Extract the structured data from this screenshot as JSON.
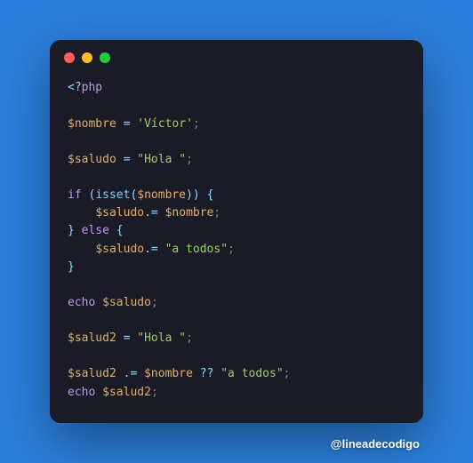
{
  "credits": "@lineadecodigo",
  "code": {
    "l1": {
      "open": "<?",
      "php": "php"
    },
    "l3": {
      "var": "$nombre",
      "eq": " = ",
      "str": "'Víctor'",
      "semi": ";"
    },
    "l5": {
      "var": "$saludo",
      "eq": " = ",
      "str": "\"Hola \"",
      "semi": ";"
    },
    "l7": {
      "kw": "if",
      "sp": " ",
      "op": "(",
      "fn": "isset",
      "op2": "(",
      "var": "$nombre",
      "cl": "))",
      "sp2": " ",
      "br": "{"
    },
    "l8": {
      "indent": "    ",
      "var": "$saludo",
      "op": ".= ",
      "var2": "$nombre",
      "semi": ";"
    },
    "l9": {
      "br": "}",
      "sp": " ",
      "kw": "else",
      "sp2": " ",
      "br2": "{"
    },
    "l10": {
      "indent": "    ",
      "var": "$saludo",
      "op": ".= ",
      "str": "\"a todos\"",
      "semi": ";"
    },
    "l11": {
      "br": "}"
    },
    "l13": {
      "kw": "echo",
      "sp": " ",
      "var": "$saludo",
      "semi": ";"
    },
    "l15": {
      "var": "$salud2",
      "eq": " = ",
      "str": "\"Hola \"",
      "semi": ";"
    },
    "l17": {
      "var": "$salud2",
      "sp": " ",
      "op": ".= ",
      "var2": "$nombre",
      "sp2": " ",
      "nq": "??",
      "sp3": " ",
      "str": "\"a todos\"",
      "semi": ";"
    },
    "l18": {
      "kw": "echo",
      "sp": " ",
      "var": "$salud2",
      "semi": ";"
    }
  }
}
